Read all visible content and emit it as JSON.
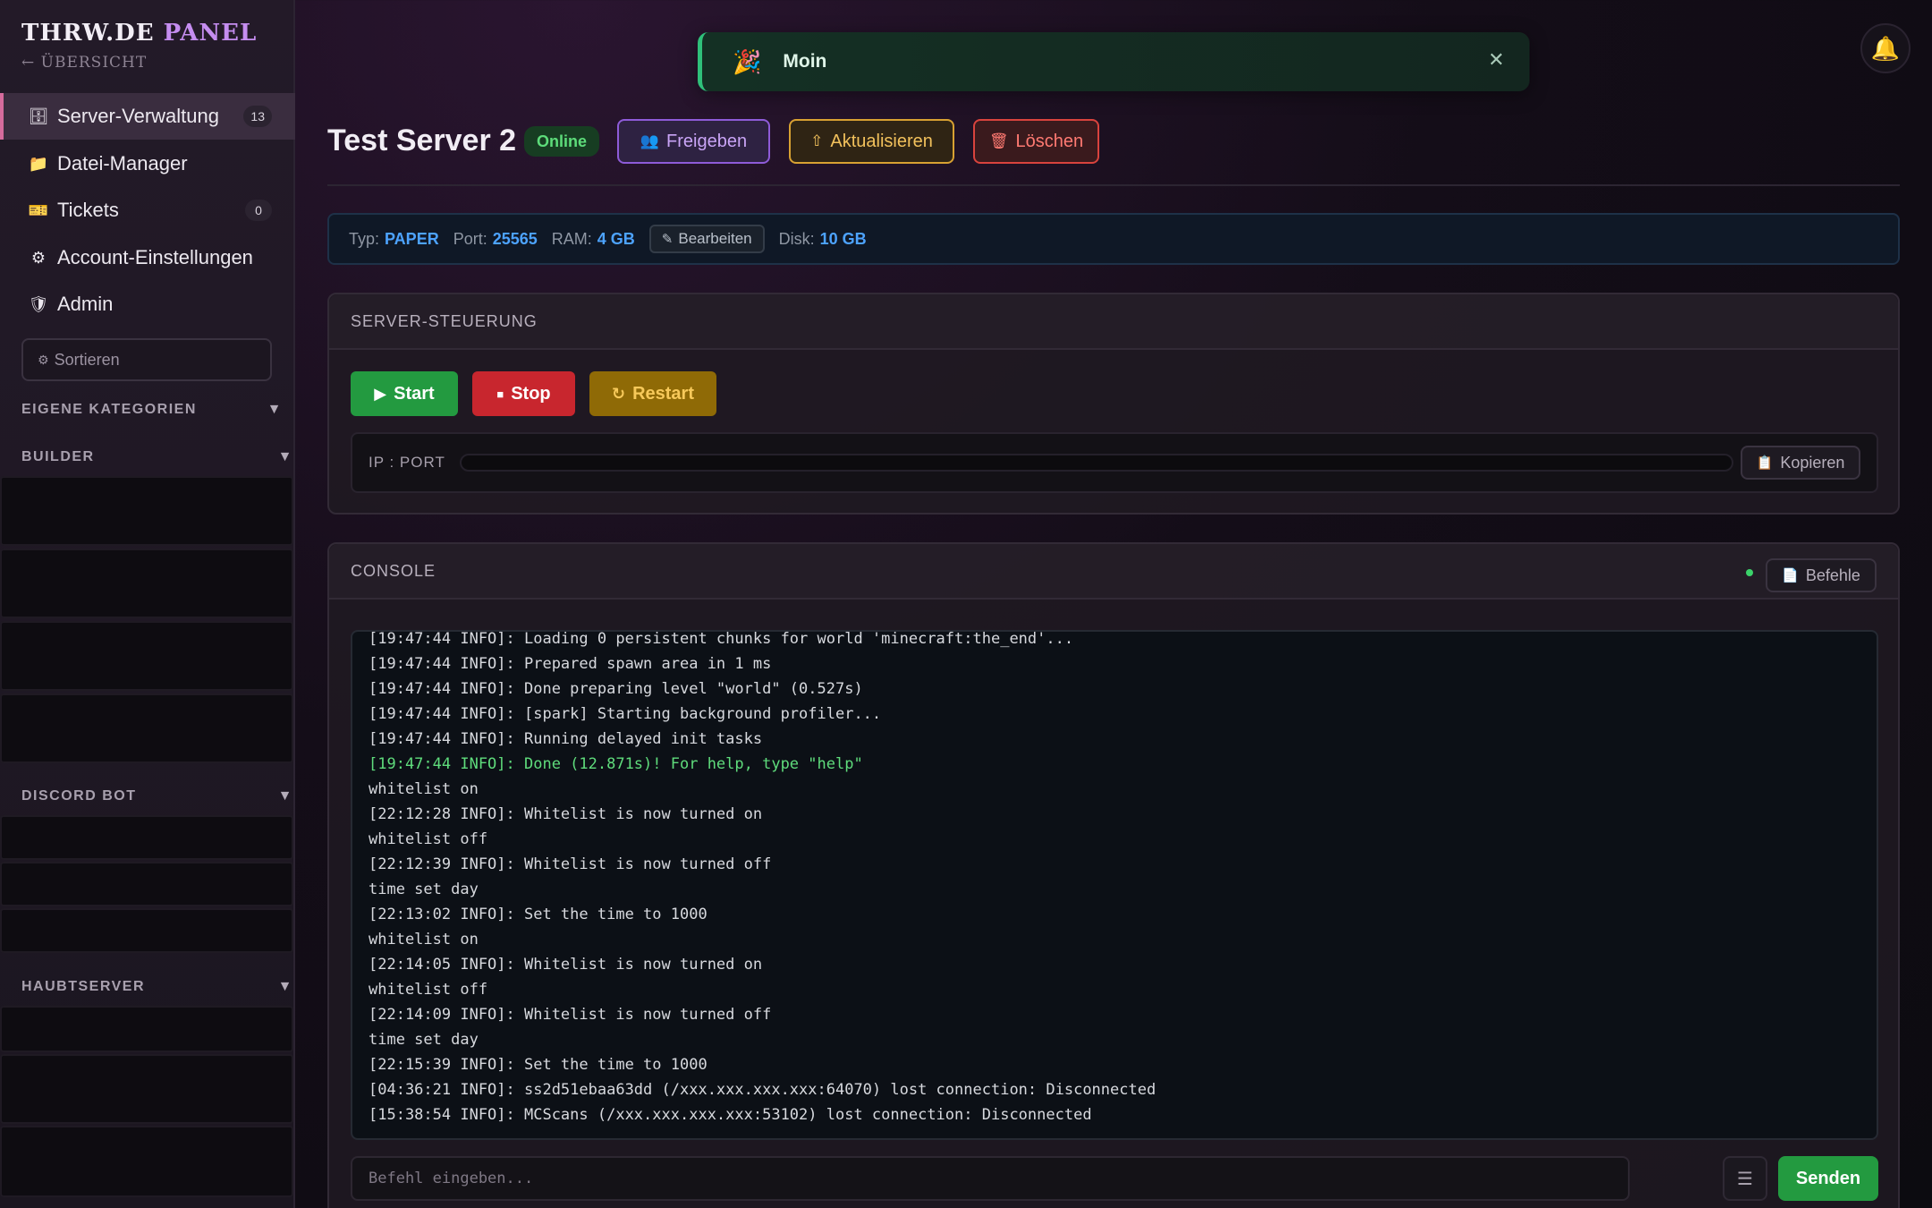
{
  "sidebar": {
    "brand_main": "THRW.DE",
    "brand_accent": "PANEL",
    "back_label": "← ÜBERSICHT",
    "nav": [
      {
        "icon": "🗄",
        "label": "Server-Verwaltung",
        "badge": "13"
      },
      {
        "icon": "📁",
        "label": "Datei-Manager",
        "badge": ""
      },
      {
        "icon": "🎫",
        "label": "Tickets",
        "badge": "0"
      },
      {
        "icon": "⚙",
        "label": "Account-Einstellungen",
        "badge": ""
      },
      {
        "icon": "🛡",
        "label": "Admin",
        "badge": ""
      }
    ],
    "sort_placeholder": "Sortieren",
    "sections": {
      "own": "EIGENE KATEGORIEN",
      "builder": "BUILDER",
      "discord": "DISCORD BOT",
      "main": "HAUBTSERVER"
    }
  },
  "toast": {
    "icon": "🎉",
    "message": "Moin",
    "close": "✕"
  },
  "header": {
    "title": "Test Server 2",
    "status": "Online",
    "share_label": "Freigeben",
    "update_label": "Aktualisieren",
    "delete_label": "Löschen"
  },
  "info": {
    "type_label": "Typ:",
    "type_value": "PAPER",
    "port_label": "Port:",
    "port_value": "25565",
    "ram_label": "RAM:",
    "ram_value": "4 GB",
    "edit_label": "Bearbeiten",
    "disk_label": "Disk:",
    "disk_value": "10 GB"
  },
  "control": {
    "heading": "SERVER-STEUERUNG",
    "start_label": "Start",
    "stop_label": "Stop",
    "restart_label": "Restart",
    "ip_label": "IP : PORT",
    "copy_label": "Kopieren"
  },
  "console": {
    "heading": "CONSOLE",
    "commands_label": "Befehle",
    "lines": [
      {
        "text": "[19:47:44 INFO]: Loading 0 persistent chunks for world 'minecraft:the_end'...",
        "done": false
      },
      {
        "text": "[19:47:44 INFO]: Prepared spawn area in 1 ms",
        "done": false
      },
      {
        "text": "[19:47:44 INFO]: Done preparing level \"world\" (0.527s)",
        "done": false
      },
      {
        "text": "[19:47:44 INFO]: [spark] Starting background profiler...",
        "done": false
      },
      {
        "text": "[19:47:44 INFO]: Running delayed init tasks",
        "done": false
      },
      {
        "text": "[19:47:44 INFO]: Done (12.871s)! For help, type \"help\"",
        "done": true
      },
      {
        "text": "whitelist on",
        "done": false
      },
      {
        "text": "[22:12:28 INFO]: Whitelist is now turned on",
        "done": false
      },
      {
        "text": "whitelist off",
        "done": false
      },
      {
        "text": "[22:12:39 INFO]: Whitelist is now turned off",
        "done": false
      },
      {
        "text": "time set day",
        "done": false
      },
      {
        "text": "[22:13:02 INFO]: Set the time to 1000",
        "done": false
      },
      {
        "text": "whitelist on",
        "done": false
      },
      {
        "text": "[22:14:05 INFO]: Whitelist is now turned on",
        "done": false
      },
      {
        "text": "whitelist off",
        "done": false
      },
      {
        "text": "[22:14:09 INFO]: Whitelist is now turned off",
        "done": false
      },
      {
        "text": "time set day",
        "done": false
      },
      {
        "text": "[22:15:39 INFO]: Set the time to 1000",
        "done": false
      },
      {
        "text": "[04:36:21 INFO]: ss2d51ebaa63dd (/xxx.xxx.xxx.xxx:64070) lost connection: Disconnected",
        "done": false
      },
      {
        "text": "[15:38:54 INFO]: MCScans (/xxx.xxx.xxx.xxx:53102) lost connection: Disconnected",
        "done": false
      }
    ],
    "input_placeholder": "Befehl eingeben...",
    "history_icon": "☰",
    "send_label": "Senden"
  },
  "colors": {
    "accent_purple": "#c58df0",
    "success_green": "#239a40",
    "danger_red": "#c8262e",
    "warning_amber": "#8f6a06",
    "info_blue": "#4da3ff"
  }
}
